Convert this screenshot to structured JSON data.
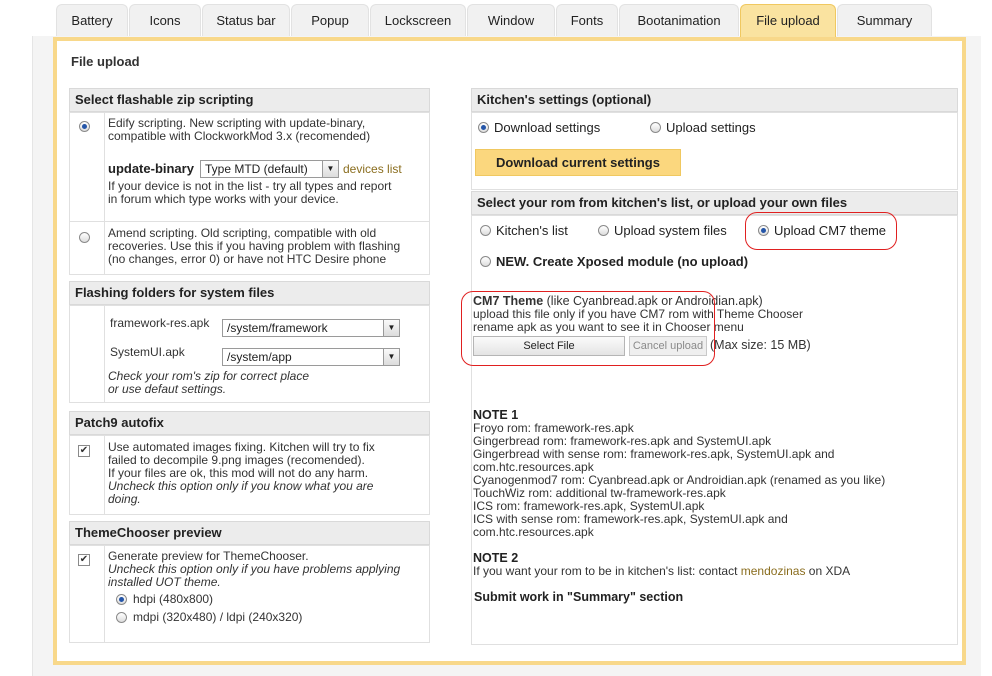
{
  "tabs": [
    "Battery",
    "Icons",
    "Status bar",
    "Popup",
    "Lockscreen",
    "Window",
    "Fonts",
    "Bootanimation",
    "File upload",
    "Summary"
  ],
  "active_tab": "File upload",
  "frame_title": "File upload",
  "flashable": {
    "heading": "Select flashable zip scripting",
    "edify_text": [
      "Edify scripting. New scripting with update-binary,",
      "compatible with ClockworkMod 3.x (recomended)"
    ],
    "update_binary_label": "update-binary",
    "update_binary_value": "Type MTD (default)",
    "devices_link": "devices list",
    "edify_note": [
      "If your device is not in the list - try all types and report",
      "in forum which type works with your device."
    ],
    "amend_text": [
      "Amend scripting. Old scripting, compatible with old",
      "recoveries. Use this if you having problem with flashing",
      "(no changes, error 0) or have not HTC Desire phone"
    ]
  },
  "folders": {
    "heading": "Flashing folders for system files",
    "framework_label": "framework-res.apk",
    "framework_value": "/system/framework",
    "systemui_label": "SystemUI.apk",
    "systemui_value": "/system/app",
    "note": [
      "Check your rom's zip for correct place",
      "or use defaut settings."
    ]
  },
  "patch9": {
    "heading": "Patch9 autofix",
    "text": [
      "Use automated images fixing. Kitchen will try to fix",
      "failed to decompile 9.png images (recomended).",
      "If your files are ok, this mod will not do any harm."
    ],
    "italic": [
      "Uncheck this option only if you know what you are",
      "doing."
    ]
  },
  "themechooser": {
    "heading": "ThemeChooser preview",
    "text": "Generate preview for ThemeChooser.",
    "italic": [
      "Uncheck this option only if you have problems applying",
      "installed UOT theme."
    ],
    "hdpi": "hdpi (480x800)",
    "mdpi": "mdpi (320x480) / ldpi (240x320)"
  },
  "kitchen_settings": {
    "heading": "Kitchen's settings (optional)",
    "download": "Download settings",
    "upload": "Upload settings",
    "download_btn": "Download current settings"
  },
  "rom": {
    "heading": "Select your rom from kitchen's list, or upload your own files",
    "kitchens_list": "Kitchen's list",
    "upload_system": "Upload system files",
    "upload_cm7": "Upload CM7 theme",
    "xposed": "NEW. Create Xposed module (no upload)"
  },
  "cm7": {
    "title": "CM7 Theme",
    "title_suffix": " (like Cyanbread.apk or Androidian.apk)",
    "line1": "upload this file only if you have CM7 rom with Theme Chooser",
    "line2": "rename apk as you want to see it in Chooser menu",
    "select_file": "Select File",
    "cancel_upload": "Cancel upload",
    "max_size": "(Max size: 15 MB)"
  },
  "note1": {
    "title": "NOTE 1",
    "lines": [
      "Froyo rom: framework-res.apk",
      "Gingerbread rom: framework-res.apk and SystemUI.apk",
      "Gingerbread with sense rom: framework-res.apk, SystemUI.apk and",
      "com.htc.resources.apk",
      "Cyanogenmod7 rom: Cyanbread.apk or Androidian.apk (renamed as you like)",
      "TouchWiz rom: additional tw-framework-res.apk",
      "ICS rom: framework-res.apk, SystemUI.apk",
      "ICS with sense rom: framework-res.apk, SystemUI.apk and",
      "com.htc.resources.apk"
    ]
  },
  "note2": {
    "title": "NOTE 2",
    "prefix": "If you want your rom to be in kitchen's list: contact ",
    "link": "mendozinas",
    "suffix": " on XDA"
  },
  "submit_note": "Submit work in \"Summary\" section"
}
